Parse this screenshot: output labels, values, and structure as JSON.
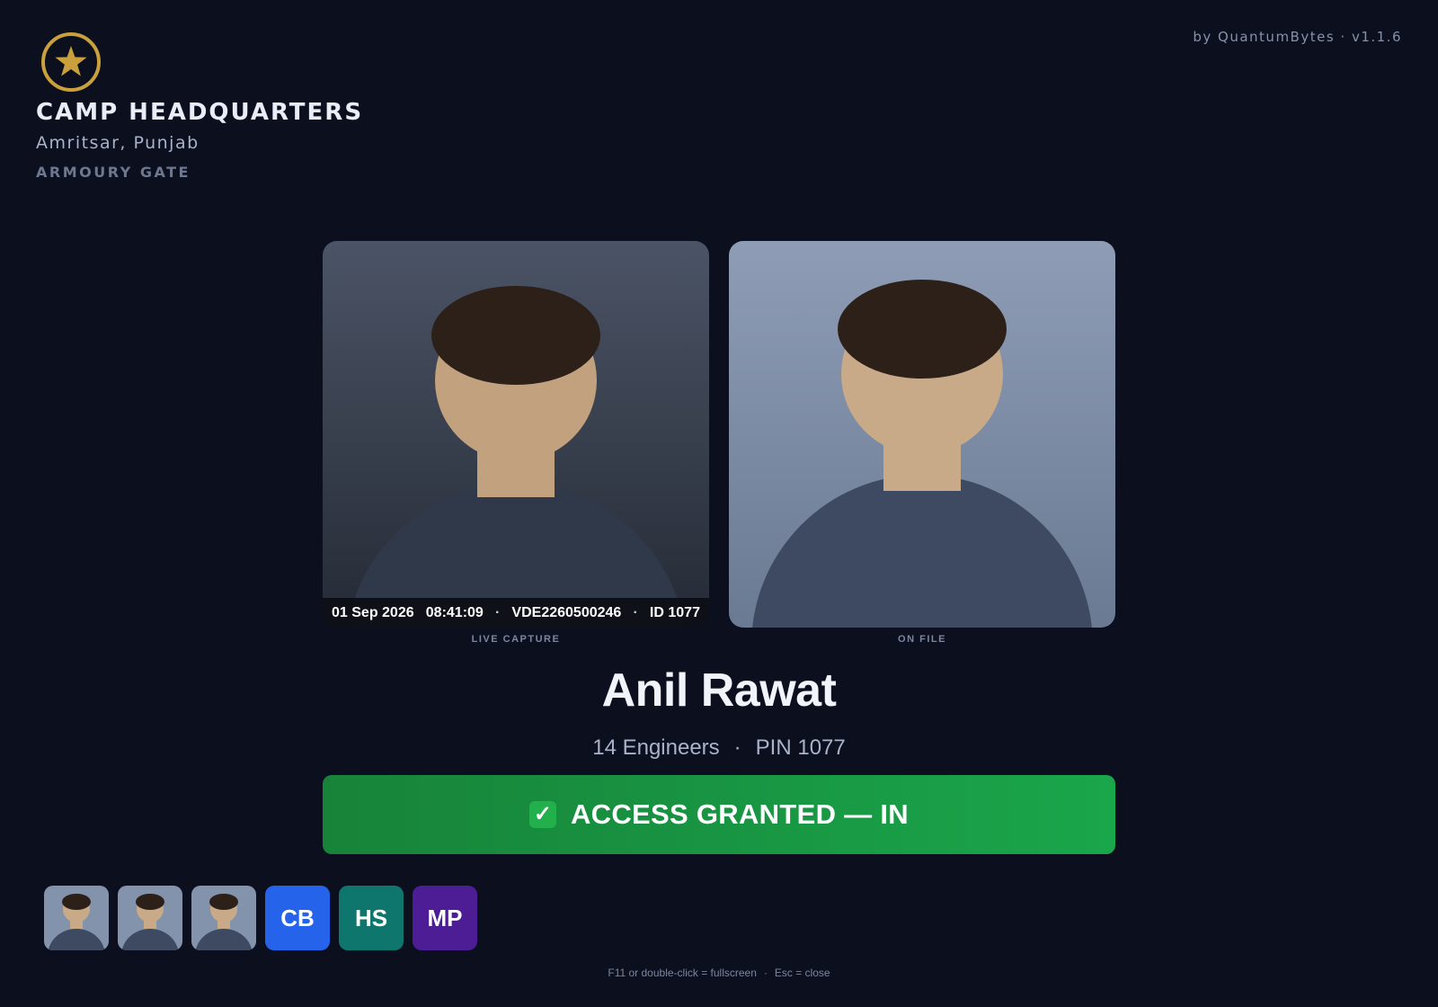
{
  "header": {
    "title": "CAMP HEADQUARTERS",
    "location": "Amritsar, Punjab",
    "gate": "ARMOURY GATE",
    "version": "by QuantumBytes · v1.1.6",
    "emblem_icon": "star-emblem-icon",
    "emblem_color": "#c9a03c"
  },
  "live_capture": {
    "label": "LIVE CAPTURE",
    "date": "01 Sep 2026",
    "time": "08:41:09",
    "separator": "·",
    "device": "VDE2260500246",
    "id": "ID 1077"
  },
  "on_file": {
    "label": "ON FILE"
  },
  "person": {
    "name": "Anil Rawat",
    "unit": "14 Engineers",
    "separator": "·",
    "pin": "PIN 1077"
  },
  "status": {
    "icon": "check-mark-icon",
    "text": "ACCESS GRANTED — IN",
    "color": "#1a9a45"
  },
  "recent_entries": [
    {
      "type": "photo",
      "icon": "person-avatar-icon"
    },
    {
      "type": "photo",
      "icon": "person-avatar-icon"
    },
    {
      "type": "photo",
      "icon": "person-avatar-icon"
    },
    {
      "type": "initials",
      "initials": "CB",
      "color": "#2563eb"
    },
    {
      "type": "initials",
      "initials": "HS",
      "color": "#0f766e"
    },
    {
      "type": "initials",
      "initials": "MP",
      "color": "#4c1d95"
    }
  ],
  "footer": {
    "fullscreen_hint": "F11 or double-click = fullscreen",
    "separator": "·",
    "close_hint": "Esc = close"
  }
}
